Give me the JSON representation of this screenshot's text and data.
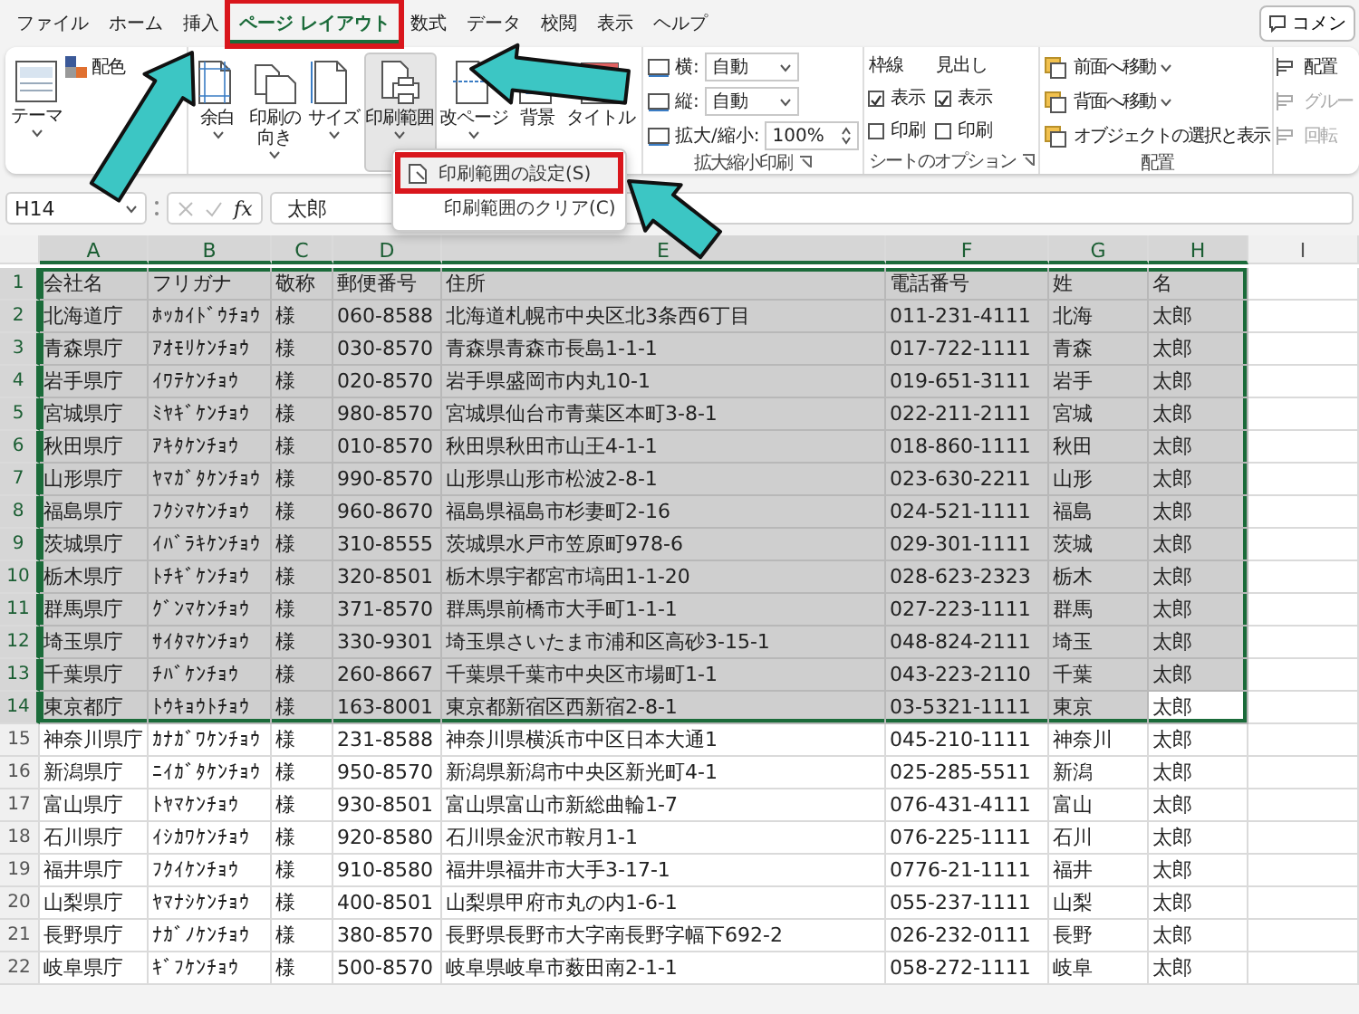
{
  "tabs": [
    {
      "label": "ファイル",
      "selected": false,
      "highlighted": false
    },
    {
      "label": "ホーム",
      "selected": false,
      "highlighted": false
    },
    {
      "label": "挿入",
      "selected": false,
      "highlighted": false
    },
    {
      "label": "ページ レイアウト",
      "selected": true,
      "highlighted": true
    },
    {
      "label": "数式",
      "selected": false,
      "highlighted": false
    },
    {
      "label": "データ",
      "selected": false,
      "highlighted": false
    },
    {
      "label": "校閲",
      "selected": false,
      "highlighted": false
    },
    {
      "label": "表示",
      "selected": false,
      "highlighted": false
    },
    {
      "label": "ヘルプ",
      "selected": false,
      "highlighted": false
    }
  ],
  "comment_button": {
    "label": "コメン"
  },
  "ribbon": {
    "theme_group": {
      "theme_button": "テーマ",
      "colors_button": "配色"
    },
    "page_setup_group": {
      "buttons": [
        {
          "label": "余白",
          "dropdown": true,
          "pressed": false
        },
        {
          "label": "印刷の向き",
          "dropdown": true,
          "pressed": false
        },
        {
          "label": "サイズ",
          "dropdown": true,
          "pressed": false
        },
        {
          "label": "印刷範囲",
          "dropdown": true,
          "pressed": true
        },
        {
          "label": "改ページ",
          "dropdown": true,
          "pressed": false
        },
        {
          "label": "背景",
          "dropdown": false,
          "pressed": false
        },
        {
          "label": "タイトル",
          "dropdown": false,
          "pressed": false
        }
      ]
    },
    "scale_group": {
      "title": "拡大縮小印刷",
      "rows": [
        {
          "kind": "dropdown",
          "label": "横:",
          "value": "自動"
        },
        {
          "kind": "dropdown",
          "label": "縦:",
          "value": "自動"
        },
        {
          "kind": "spinner",
          "label": "拡大/縮小:",
          "value": "100%"
        }
      ]
    },
    "sheet_options_group": {
      "title": "シートのオプション",
      "columns": [
        {
          "heading": "枠線",
          "options": [
            {
              "label": "表示",
              "checked": true
            },
            {
              "label": "印刷",
              "checked": false
            }
          ]
        },
        {
          "heading": "見出し",
          "options": [
            {
              "label": "表示",
              "checked": true
            },
            {
              "label": "印刷",
              "checked": false
            }
          ]
        }
      ]
    },
    "arrange_group": {
      "title": "配置",
      "items": [
        {
          "label": "前面へ移動",
          "dropdown": true
        },
        {
          "label": "背面へ移動",
          "dropdown": true
        },
        {
          "label": "オブジェクトの選択と表示",
          "dropdown": false
        }
      ]
    },
    "arrange_more": [
      {
        "label": "配置",
        "disabled": false
      },
      {
        "label": "グルー",
        "disabled": true
      },
      {
        "label": "回転",
        "disabled": true
      }
    ]
  },
  "print_area_menu": {
    "items": [
      {
        "label": "印刷範囲の設定(S)",
        "icon": true,
        "highlighted": true
      },
      {
        "label": "印刷範囲のクリア(C)",
        "icon": false,
        "highlighted": false
      }
    ]
  },
  "formula_bar": {
    "name_box": "H14",
    "function_label": "fx",
    "formula": "太郎"
  },
  "sheet": {
    "columns": [
      {
        "label": "A",
        "selected": true
      },
      {
        "label": "B",
        "selected": true
      },
      {
        "label": "C",
        "selected": true
      },
      {
        "label": "D",
        "selected": true
      },
      {
        "label": "E",
        "selected": true
      },
      {
        "label": "F",
        "selected": true
      },
      {
        "label": "G",
        "selected": true
      },
      {
        "label": "H",
        "selected": true
      },
      {
        "label": "I",
        "selected": false
      }
    ],
    "rows": [
      {
        "header": "1",
        "selected": true,
        "last_cell_active": false,
        "cells": [
          "会社名",
          "フリガナ",
          "敬称",
          "郵便番号",
          "住所",
          "電話番号",
          "姓",
          "名"
        ]
      },
      {
        "header": "2",
        "selected": true,
        "last_cell_active": false,
        "cells": [
          "北海道庁",
          "ﾎｯｶｲﾄﾞｳﾁｮｳ",
          "様",
          "060-8588",
          "北海道札幌市中央区北3条西6丁目",
          "011-231-4111",
          "北海",
          "太郎"
        ]
      },
      {
        "header": "3",
        "selected": true,
        "last_cell_active": false,
        "cells": [
          "青森県庁",
          "ｱｵﾓﾘｹﾝﾁｮｳ",
          "様",
          "030-8570",
          "青森県青森市長島1-1-1",
          "017-722-1111",
          "青森",
          "太郎"
        ]
      },
      {
        "header": "4",
        "selected": true,
        "last_cell_active": false,
        "cells": [
          "岩手県庁",
          "ｲﾜﾃｹﾝﾁｮｳ",
          "様",
          "020-8570",
          "岩手県盛岡市内丸10-1",
          "019-651-3111",
          "岩手",
          "太郎"
        ]
      },
      {
        "header": "5",
        "selected": true,
        "last_cell_active": false,
        "cells": [
          "宮城県庁",
          "ﾐﾔｷﾞｹﾝﾁｮｳ",
          "様",
          "980-8570",
          "宮城県仙台市青葉区本町3-8-1",
          "022-211-2111",
          "宮城",
          "太郎"
        ]
      },
      {
        "header": "6",
        "selected": true,
        "last_cell_active": false,
        "cells": [
          "秋田県庁",
          "ｱｷﾀｹﾝﾁｮｳ",
          "様",
          "010-8570",
          "秋田県秋田市山王4-1-1",
          "018-860-1111",
          "秋田",
          "太郎"
        ]
      },
      {
        "header": "7",
        "selected": true,
        "last_cell_active": false,
        "cells": [
          "山形県庁",
          "ﾔﾏｶﾞﾀｹﾝﾁｮｳ",
          "様",
          "990-8570",
          "山形県山形市松波2-8-1",
          "023-630-2211",
          "山形",
          "太郎"
        ]
      },
      {
        "header": "8",
        "selected": true,
        "last_cell_active": false,
        "cells": [
          "福島県庁",
          "ﾌｸｼﾏｹﾝﾁｮｳ",
          "様",
          "960-8670",
          "福島県福島市杉妻町2-16",
          "024-521-1111",
          "福島",
          "太郎"
        ]
      },
      {
        "header": "9",
        "selected": true,
        "last_cell_active": false,
        "cells": [
          "茨城県庁",
          "ｲﾊﾞﾗｷｹﾝﾁｮｳ",
          "様",
          "310-8555",
          "茨城県水戸市笠原町978-6",
          "029-301-1111",
          "茨城",
          "太郎"
        ]
      },
      {
        "header": "10",
        "selected": true,
        "last_cell_active": false,
        "cells": [
          "栃木県庁",
          "ﾄﾁｷﾞｹﾝﾁｮｳ",
          "様",
          "320-8501",
          "栃木県宇都宮市塙田1-1-20",
          "028-623-2323",
          "栃木",
          "太郎"
        ]
      },
      {
        "header": "11",
        "selected": true,
        "last_cell_active": false,
        "cells": [
          "群馬県庁",
          "ｸﾞﾝﾏｹﾝﾁｮｳ",
          "様",
          "371-8570",
          "群馬県前橋市大手町1-1-1",
          "027-223-1111",
          "群馬",
          "太郎"
        ]
      },
      {
        "header": "12",
        "selected": true,
        "last_cell_active": false,
        "cells": [
          "埼玉県庁",
          "ｻｲﾀﾏｹﾝﾁｮｳ",
          "様",
          "330-9301",
          "埼玉県さいたま市浦和区高砂3-15-1",
          "048-824-2111",
          "埼玉",
          "太郎"
        ]
      },
      {
        "header": "13",
        "selected": true,
        "last_cell_active": false,
        "cells": [
          "千葉県庁",
          "ﾁﾊﾞｹﾝﾁｮｳ",
          "様",
          "260-8667",
          "千葉県千葉市中央区市場町1-1",
          "043-223-2110",
          "千葉",
          "太郎"
        ]
      },
      {
        "header": "14",
        "selected": true,
        "last_cell_active": true,
        "cells": [
          "東京都庁",
          "ﾄｳｷｮｳﾄﾁｮｳ",
          "様",
          "163-8001",
          "東京都新宿区西新宿2-8-1",
          "03-5321-1111",
          "東京",
          "太郎"
        ]
      },
      {
        "header": "15",
        "selected": false,
        "last_cell_active": false,
        "cells": [
          "神奈川県庁",
          "ｶﾅｶﾞﾜｹﾝﾁｮｳ",
          "様",
          "231-8588",
          "神奈川県横浜市中区日本大通1",
          "045-210-1111",
          "神奈川",
          "太郎"
        ]
      },
      {
        "header": "16",
        "selected": false,
        "last_cell_active": false,
        "cells": [
          "新潟県庁",
          "ﾆｲｶﾞﾀｹﾝﾁｮｳ",
          "様",
          "950-8570",
          "新潟県新潟市中央区新光町4-1",
          "025-285-5511",
          "新潟",
          "太郎"
        ]
      },
      {
        "header": "17",
        "selected": false,
        "last_cell_active": false,
        "cells": [
          "富山県庁",
          "ﾄﾔﾏｹﾝﾁｮｳ",
          "様",
          "930-8501",
          "富山県富山市新総曲輪1-7",
          "076-431-4111",
          "富山",
          "太郎"
        ]
      },
      {
        "header": "18",
        "selected": false,
        "last_cell_active": false,
        "cells": [
          "石川県庁",
          "ｲｼｶﾜｹﾝﾁｮｳ",
          "様",
          "920-8580",
          "石川県金沢市鞍月1-1",
          "076-225-1111",
          "石川",
          "太郎"
        ]
      },
      {
        "header": "19",
        "selected": false,
        "last_cell_active": false,
        "cells": [
          "福井県庁",
          "ﾌｸｲｹﾝﾁｮｳ",
          "様",
          "910-8580",
          "福井県福井市大手3-17-1",
          "0776-21-1111",
          "福井",
          "太郎"
        ]
      },
      {
        "header": "20",
        "selected": false,
        "last_cell_active": false,
        "cells": [
          "山梨県庁",
          "ﾔﾏﾅｼｹﾝﾁｮｳ",
          "様",
          "400-8501",
          "山梨県甲府市丸の内1-6-1",
          "055-237-1111",
          "山梨",
          "太郎"
        ]
      },
      {
        "header": "21",
        "selected": false,
        "last_cell_active": false,
        "cells": [
          "長野県庁",
          "ﾅｶﾞﾉｹﾝﾁｮｳ",
          "様",
          "380-8570",
          "長野県長野市大字南長野字幅下692-2",
          "026-232-0111",
          "長野",
          "太郎"
        ]
      },
      {
        "header": "22",
        "selected": false,
        "last_cell_active": false,
        "cells": [
          "岐阜県庁",
          "ｷﾞﾌｹﾝﾁｮｳ",
          "様",
          "500-8570",
          "岐阜県岐阜市薮田南2-1-1",
          "058-272-1111",
          "岐阜",
          "太郎"
        ]
      }
    ]
  }
}
